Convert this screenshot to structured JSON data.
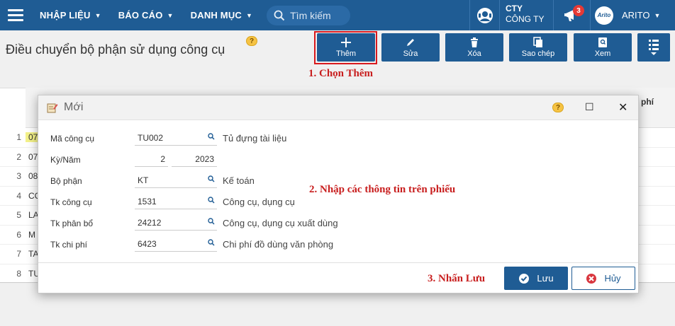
{
  "nav": {
    "menu1": "NHẬP LIỆU",
    "menu2": "BÁO CÁO",
    "menu3": "DANH MỤC",
    "search_placeholder": "Tìm kiếm",
    "company_line1": "CTY",
    "company_line2": "CÔNG TY",
    "notification_count": "3",
    "avatar_text": "Arito",
    "user_name": "ARITO"
  },
  "page": {
    "title": "Điều chuyển bộ phận sử dụng công cụ",
    "help": "?"
  },
  "toolbar": {
    "add": "Thêm",
    "edit": "Sửa",
    "delete": "Xóa",
    "copy": "Sao chép",
    "view": "Xem"
  },
  "steps": {
    "step1": "1. Chọn Thêm",
    "step2": "2. Nhập các thông tin trên phiếu",
    "step3": "3. Nhấn Lưu"
  },
  "grid": {
    "header_fragment": "phí",
    "rows": [
      {
        "n": "1",
        "c": "07"
      },
      {
        "n": "2",
        "c": "07"
      },
      {
        "n": "3",
        "c": "08"
      },
      {
        "n": "4",
        "c": "CC"
      },
      {
        "n": "5",
        "c": "LA"
      },
      {
        "n": "6",
        "c": "M"
      },
      {
        "n": "7",
        "c": "TA"
      },
      {
        "n": "8",
        "c": "TU"
      }
    ]
  },
  "dialog": {
    "title": "Mới",
    "help": "?",
    "fields": {
      "tool_code_label": "Mã công cụ",
      "tool_code_value": "TU002",
      "tool_code_desc": "Tủ đựng tài liệu",
      "period_label": "Kỳ/Năm",
      "period_value": "2",
      "year_value": "2023",
      "dept_label": "Bộ phận",
      "dept_value": "KT",
      "dept_desc": "Kế toán",
      "tool_acct_label": "Tk công cụ",
      "tool_acct_value": "1531",
      "tool_acct_desc": "Công cụ, dụng cụ",
      "alloc_acct_label": "Tk phân bổ",
      "alloc_acct_value": "24212",
      "alloc_acct_desc": "Công cụ, dụng cụ xuất dùng",
      "expense_acct_label": "Tk chi phí",
      "expense_acct_value": "6423",
      "expense_acct_desc": "Chi phí đồ dùng văn phòng"
    },
    "save_label": "Lưu",
    "cancel_label": "Hủy"
  }
}
